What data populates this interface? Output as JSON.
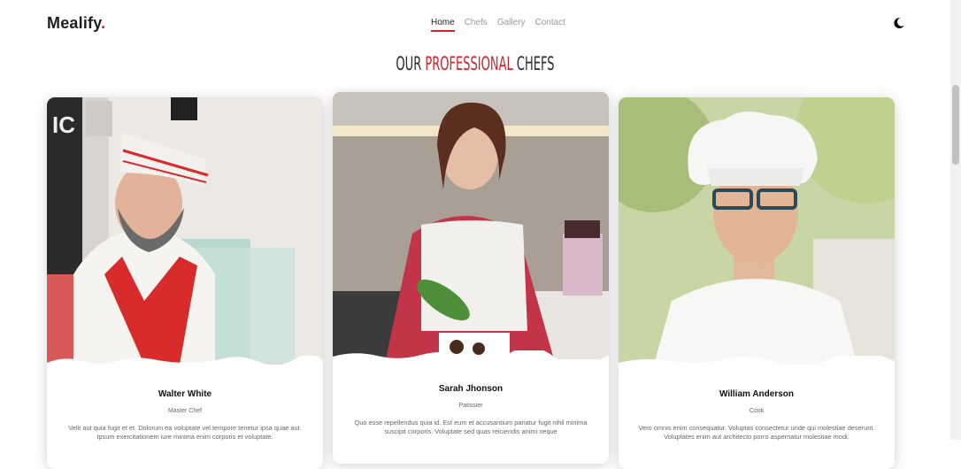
{
  "header": {
    "logo_text": "Mealify",
    "logo_dot": ".",
    "nav": [
      {
        "label": "Home",
        "active": true
      },
      {
        "label": "Chefs",
        "active": false
      },
      {
        "label": "Gallery",
        "active": false
      },
      {
        "label": "Contact",
        "active": false
      }
    ],
    "theme_icon": "moon-icon"
  },
  "section": {
    "title_pre": "Our ",
    "title_accent": "Professional",
    "title_post": " Chefs"
  },
  "chefs": [
    {
      "name": "Walter White",
      "role": "Master Chef",
      "bio": "Velit aut quia fugit et et. Dolorum ea voluptate vel tempore tenetur ipsa quae aut. Ipsum exercitationem iure minima enim corporis et voluptate."
    },
    {
      "name": "Sarah Jhonson",
      "role": "Patissier",
      "bio": "Quo esse repellendus quia id. Est eum et accusantium pariatur fugit nihil minima suscipit corporis. Voluptate sed quas reiciendis animi neque"
    },
    {
      "name": "William Anderson",
      "role": "Cook",
      "bio": "Vero omnis enim consequatur. Voluptas consectetur unde qui molestiae deserunt. Voluptates enim aut architecto porro aspernatur molestiae modi."
    }
  ],
  "colors": {
    "accent": "#d3212d",
    "text": "#222222",
    "muted": "#9a9a9a"
  }
}
